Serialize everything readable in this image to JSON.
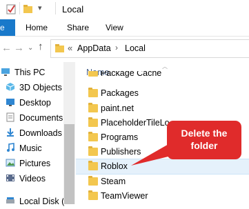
{
  "window": {
    "title": "Local"
  },
  "ribbon": {
    "tabs": [
      {
        "label": "e"
      },
      {
        "label": "Home"
      },
      {
        "label": "Share"
      },
      {
        "label": "View"
      }
    ]
  },
  "address": {
    "overflow": "«",
    "path": [
      "AppData",
      "Local"
    ]
  },
  "nav": {
    "items": [
      {
        "label": "This PC",
        "icon": "this-pc-icon"
      },
      {
        "label": "3D Objects",
        "icon": "3d-objects-icon"
      },
      {
        "label": "Desktop",
        "icon": "desktop-icon"
      },
      {
        "label": "Documents",
        "icon": "documents-icon"
      },
      {
        "label": "Downloads",
        "icon": "downloads-icon"
      },
      {
        "label": "Music",
        "icon": "music-icon"
      },
      {
        "label": "Pictures",
        "icon": "pictures-icon"
      },
      {
        "label": "Videos",
        "icon": "videos-icon"
      },
      {
        "label": "Local Disk (",
        "icon": "drive-icon"
      }
    ]
  },
  "list": {
    "column_name": "Name",
    "rows": [
      {
        "name": "Package Cache"
      },
      {
        "name": "Packages"
      },
      {
        "name": "paint.net"
      },
      {
        "name": "PlaceholderTileLo"
      },
      {
        "name": "Programs"
      },
      {
        "name": "Publishers"
      },
      {
        "name": "Roblox"
      },
      {
        "name": "Steam"
      },
      {
        "name": "TeamViewer"
      }
    ]
  },
  "callout": {
    "text_line1": "Delete the",
    "text_line2": "folder",
    "color": "#e02b2b"
  },
  "colors": {
    "accent": "#1979ca",
    "folder": "#f3c74f"
  }
}
